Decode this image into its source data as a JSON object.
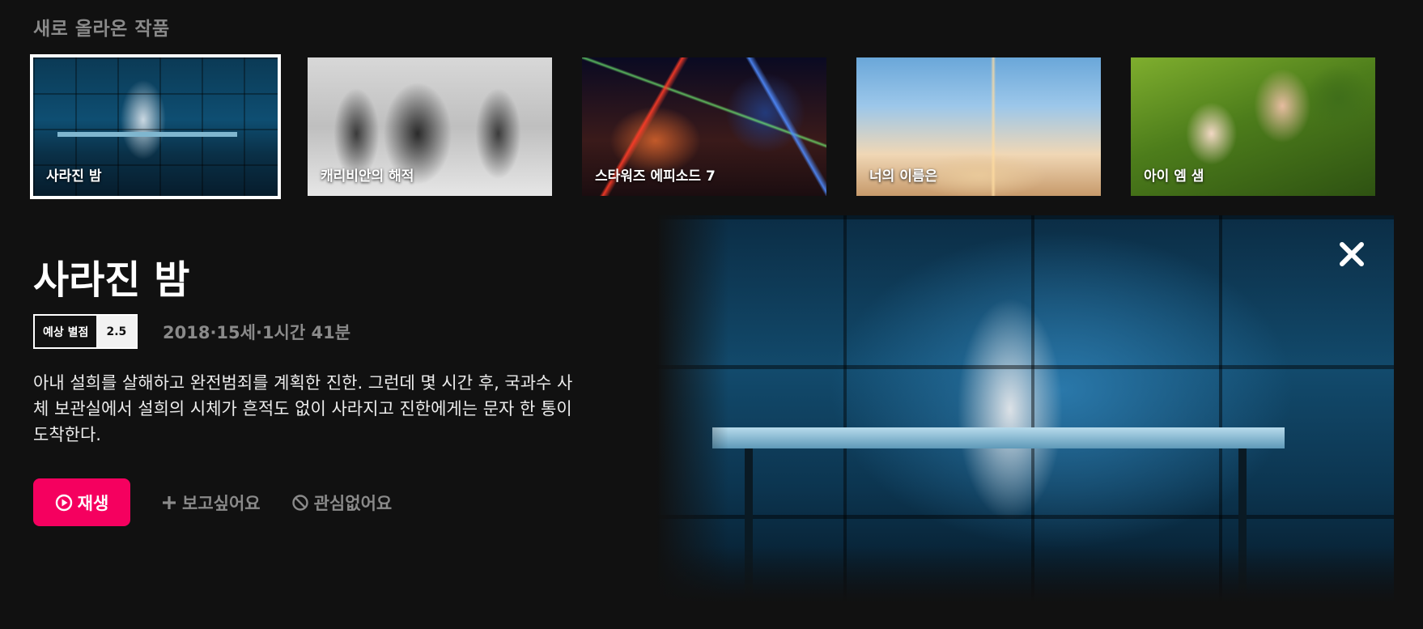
{
  "section": {
    "title": "새로 올라온 작품"
  },
  "thumbnails": [
    {
      "label": "사라진 밤",
      "selected": true
    },
    {
      "label": "캐리비안의 해적",
      "selected": false
    },
    {
      "label": "스타워즈 에피소드 7",
      "selected": false
    },
    {
      "label": "너의 이름은",
      "selected": false
    },
    {
      "label": "아이 엠 샘",
      "selected": false
    }
  ],
  "detail": {
    "title": "사라진 밤",
    "rating_label": "예상 별점",
    "rating_value": "2.5",
    "meta": "2018·15세·1시간 41분",
    "description": "아내 설희를 살해하고 완전범죄를 계획한 진한. 그런데 몇 시간 후, 국과수 사체 보관실에서 설희의 시체가 흔적도 없이 사라지고 진한에게는 문자 한 통이 도착한다.",
    "play_label": "재생",
    "wishlist_label": "보고싶어요",
    "not_interested_label": "관심없어요"
  },
  "icons": {
    "play": "play-circle-icon",
    "wishlist": "plus-icon",
    "not_interested": "ban-icon",
    "close": "close-icon"
  },
  "colors": {
    "background": "#111111",
    "accent": "#f5005f",
    "muted_text": "#8a8a8a"
  }
}
